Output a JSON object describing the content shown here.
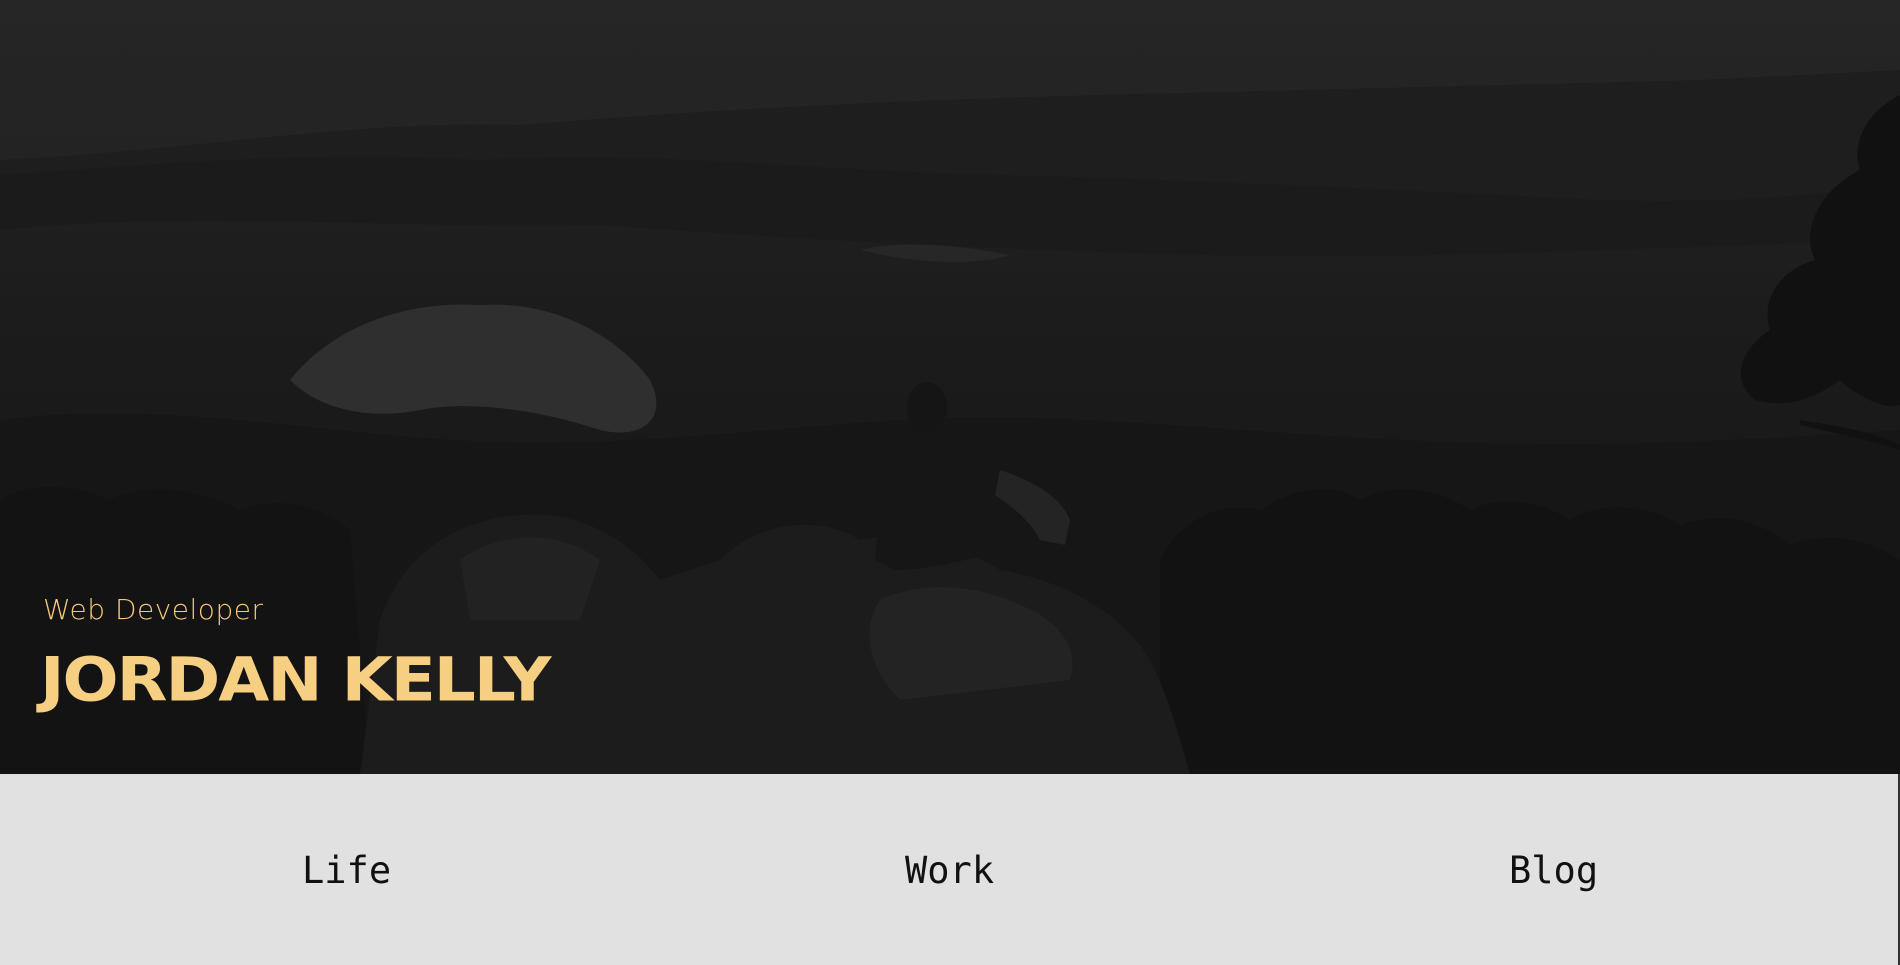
{
  "hero": {
    "subtitle": "Web Developer",
    "name": "JORDAN KELLY",
    "background_image": "dark landscape photo of a person sitting on rocks overlooking hills and trees"
  },
  "nav": {
    "items": [
      {
        "label": "Life"
      },
      {
        "label": "Work"
      },
      {
        "label": "Blog"
      }
    ]
  },
  "colors": {
    "accent": "#f7cf82",
    "nav_background": "#e1e1e1",
    "nav_text": "#111111",
    "hero_overlay": "#2a2a2a"
  }
}
